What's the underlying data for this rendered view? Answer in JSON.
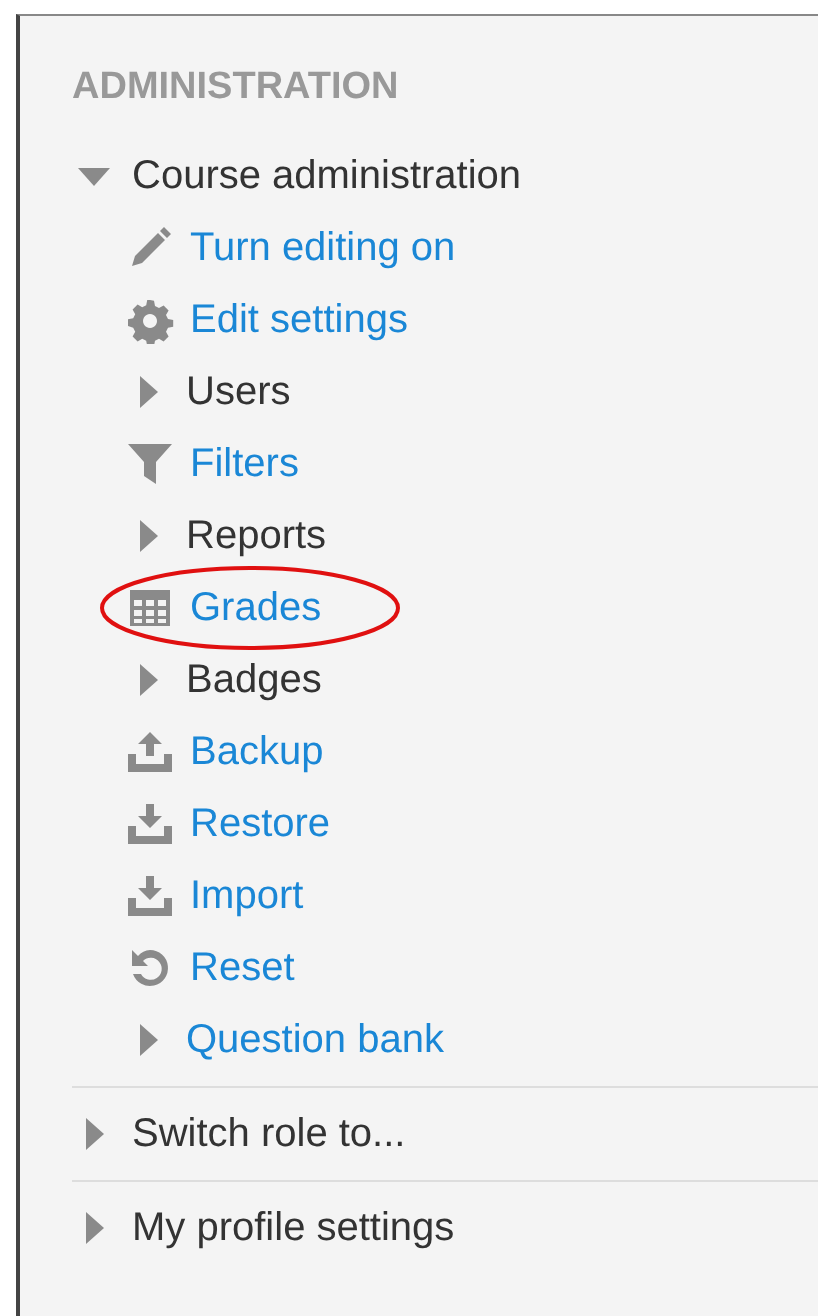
{
  "block": {
    "title": "ADMINISTRATION"
  },
  "sections": [
    {
      "label": "Course administration",
      "expanded": true,
      "children": [
        {
          "label": "Turn editing on",
          "kind": "link",
          "circled": false
        },
        {
          "label": "Edit settings",
          "kind": "link",
          "circled": false
        },
        {
          "label": "Users",
          "kind": "branch",
          "circled": false
        },
        {
          "label": "Filters",
          "kind": "link",
          "circled": false
        },
        {
          "label": "Reports",
          "kind": "branch",
          "circled": false
        },
        {
          "label": "Grades",
          "kind": "link",
          "circled": true
        },
        {
          "label": "Badges",
          "kind": "branch",
          "circled": false
        },
        {
          "label": "Backup",
          "kind": "link",
          "circled": false
        },
        {
          "label": "Restore",
          "kind": "link",
          "circled": false
        },
        {
          "label": "Import",
          "kind": "link",
          "circled": false
        },
        {
          "label": "Reset",
          "kind": "link",
          "circled": false
        },
        {
          "label": "Question bank",
          "kind": "branch-link",
          "circled": false
        }
      ]
    },
    {
      "label": "Switch role to...",
      "expanded": false
    },
    {
      "label": "My profile settings",
      "expanded": false
    }
  ]
}
